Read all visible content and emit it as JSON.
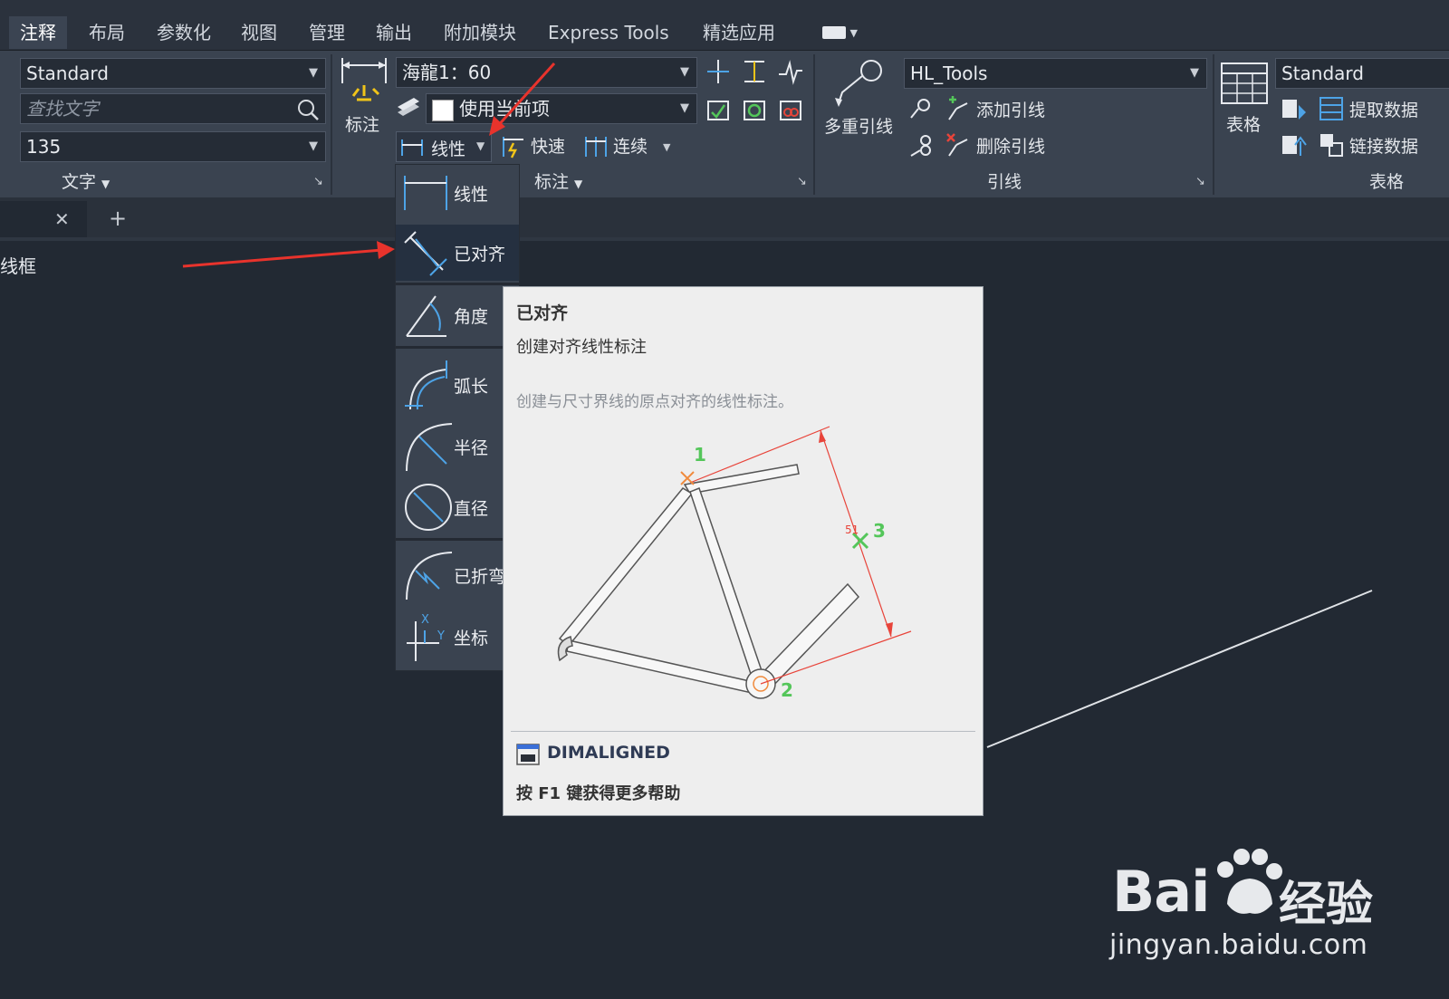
{
  "tabs": [
    {
      "label": "注释",
      "active": true
    },
    {
      "label": "布局"
    },
    {
      "label": "参数化"
    },
    {
      "label": "视图"
    },
    {
      "label": "管理"
    },
    {
      "label": "输出"
    },
    {
      "label": "附加模块"
    },
    {
      "label": "Express Tools"
    },
    {
      "label": "精选应用"
    }
  ],
  "text_panel": {
    "style_value": "Standard",
    "find_placeholder": "查找文字",
    "height_value": "135",
    "title": "文字"
  },
  "dim_panel": {
    "dim_label": "标注",
    "dim_style_value": "海龍1：60",
    "layer_value": "使用当前项",
    "linear_label": "线性",
    "quick_label": "快速",
    "continue_label": "连续",
    "title": "标注"
  },
  "leader_panel": {
    "multileader_label": "多重引线",
    "style_value": "HL_Tools",
    "add_label": "添加引线",
    "remove_label": "删除引线",
    "title": "引线"
  },
  "table_panel": {
    "table_label": "表格",
    "style_value": "Standard",
    "extract_label": "提取数据",
    "link_label": "链接数据",
    "title": "表格"
  },
  "doc_tab": {
    "close": "✕",
    "add": "+"
  },
  "drawing_text": "线框",
  "dropdown_items": [
    {
      "label": "线性"
    },
    {
      "label": "已对齐",
      "highlighted": true
    },
    {
      "label": "角度"
    },
    {
      "label": "弧长"
    },
    {
      "label": "半径"
    },
    {
      "label": "直径"
    },
    {
      "label": "已折弯"
    },
    {
      "label": "坐标"
    }
  ],
  "tooltip": {
    "title": "已对齐",
    "subtitle": "创建对齐线性标注",
    "description": "创建与尺寸界线的原点对齐的线性标注。",
    "point1": "1",
    "point2": "2",
    "point3": "3",
    "dim_value": "51",
    "command": "DIMALIGNED",
    "help": "按 F1 键获得更多帮助"
  },
  "watermark": {
    "brand": "Bai",
    "brand_suffix": "经验",
    "url": "jingyan.baidu.com"
  },
  "colors": {
    "annotation_arrow": "#e8332c",
    "accent_blue": "#4da3e6",
    "dim_red": "#e8443a",
    "point_green": "#54c65a"
  }
}
